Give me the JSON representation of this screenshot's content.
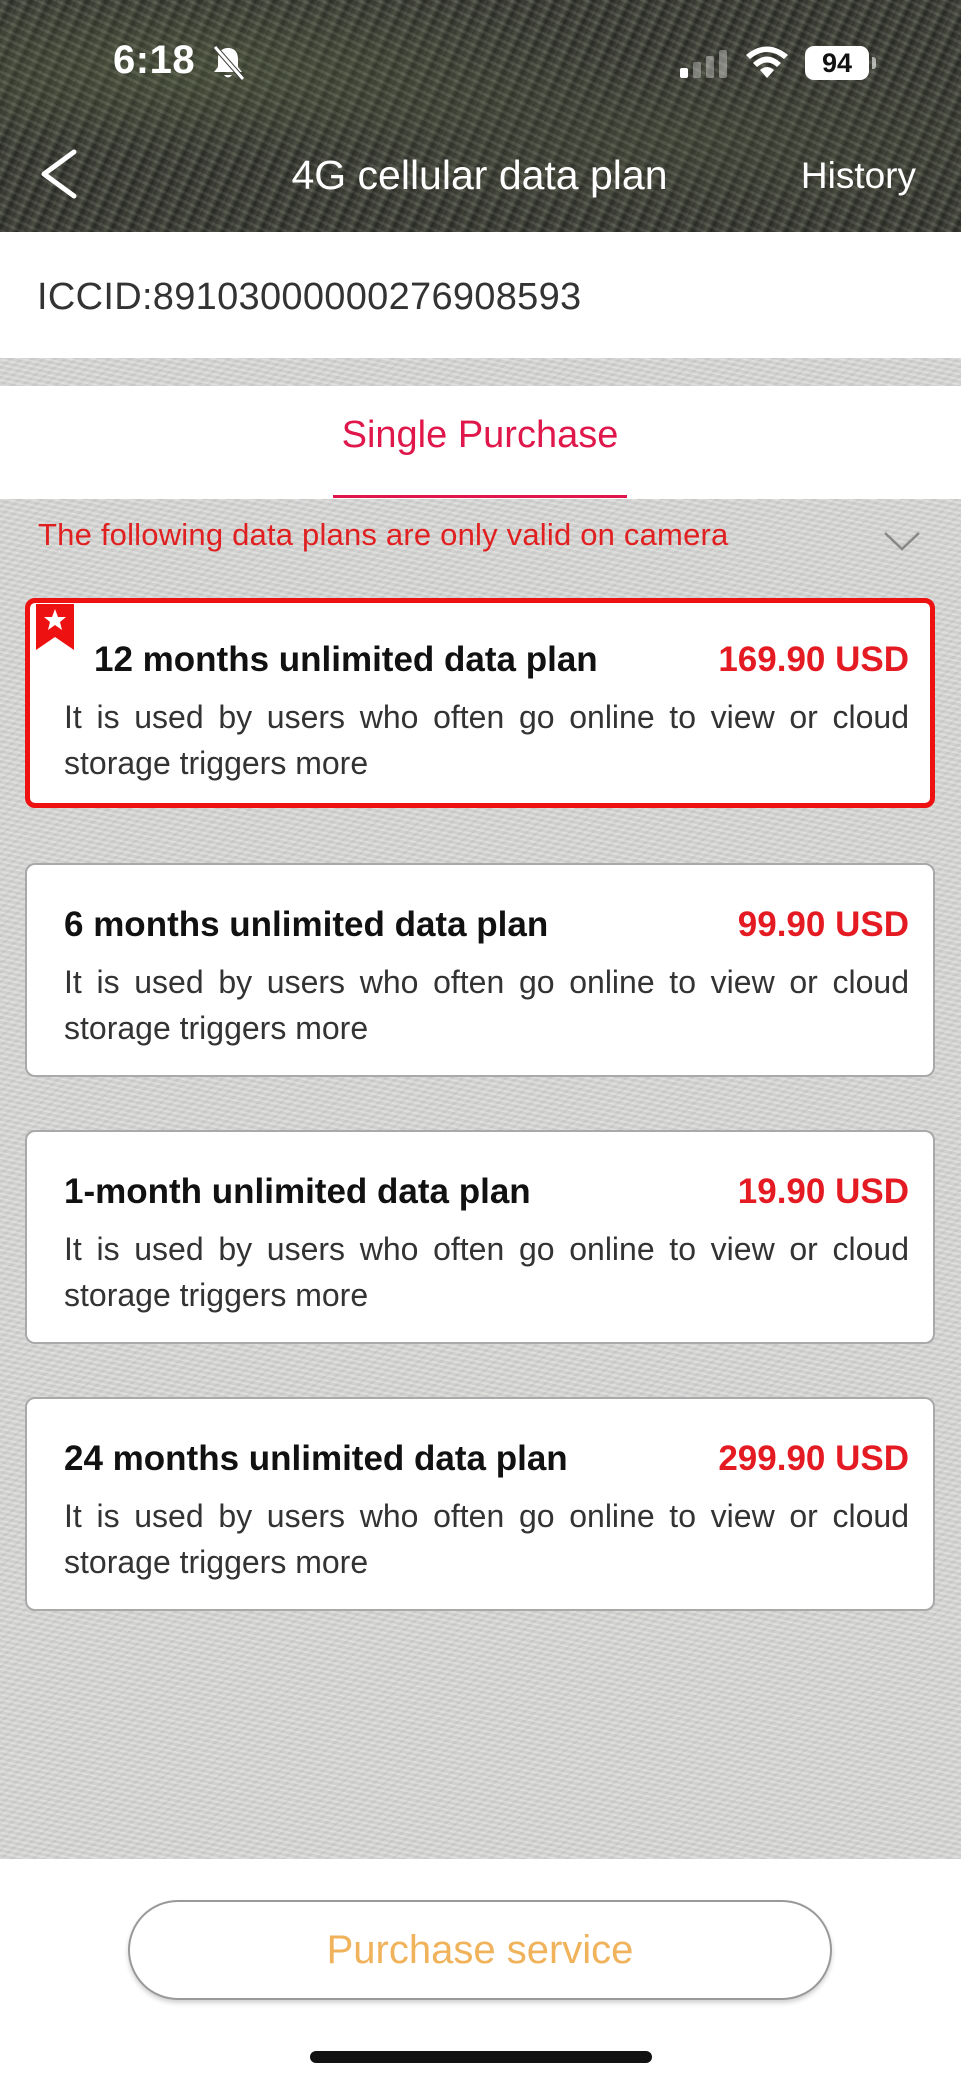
{
  "status_bar": {
    "time": "6:18",
    "battery": "94",
    "icons": [
      "bell-slash-icon",
      "signal-icon",
      "wifi-icon",
      "battery-icon"
    ]
  },
  "header": {
    "title": "4G cellular data plan",
    "history_label": "History",
    "back_icon": "chevron-left-icon"
  },
  "iccid": {
    "text": "ICCID:89103000000276908593"
  },
  "tabs": [
    {
      "label": "Single Purchase",
      "active": true
    }
  ],
  "notice": {
    "text": "The following data plans are only valid on camera",
    "icon": "chevron-down-icon"
  },
  "plans": [
    {
      "name": "12 months unlimited data plan",
      "price": "169.90 USD",
      "description": "It is used by users who often go online to view or cloud storage triggers more",
      "selected": true,
      "badge_icon": "bookmark-star-icon"
    },
    {
      "name": "6 months unlimited data plan",
      "price": "99.90 USD",
      "description": "It is used by users who often go online to view or cloud storage triggers more",
      "selected": false
    },
    {
      "name": "1-month unlimited data plan",
      "price": "19.90 USD",
      "description": "It is used by users who often go online to view or cloud storage triggers more",
      "selected": false
    },
    {
      "name": "24 months unlimited data plan",
      "price": "299.90 USD",
      "description": "It is used by users who often go online to view or cloud storage triggers more",
      "selected": false
    }
  ],
  "footer": {
    "purchase_label": "Purchase service"
  },
  "colors": {
    "accent_tab": "#e0174a",
    "price": "#e51b23",
    "selected_border": "#ee1111",
    "purchase_text": "#f0b25a"
  }
}
